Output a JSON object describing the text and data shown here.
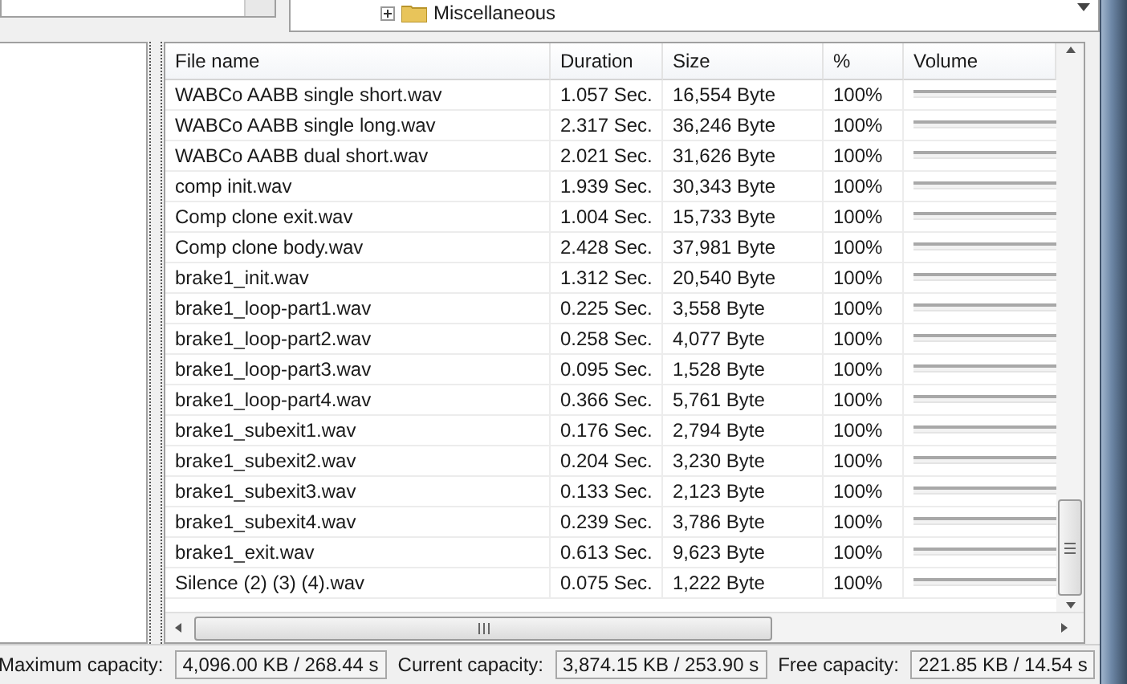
{
  "tree": {
    "items": [
      {
        "label": "Miscellaneous",
        "expanded": false
      }
    ]
  },
  "table": {
    "columns": [
      "File name",
      "Duration",
      "Size",
      "%",
      "Volume"
    ],
    "rows": [
      {
        "file_name": "WABCo AABB single short.wav",
        "duration": "1.057 Sec.",
        "size": "16,554 Byte",
        "percent": "100%",
        "volume": {
          "level": 1
        }
      },
      {
        "file_name": "WABCo AABB single long.wav",
        "duration": "2.317 Sec.",
        "size": "36,246 Byte",
        "percent": "100%",
        "volume": {
          "level": 1
        }
      },
      {
        "file_name": "WABCo AABB dual short.wav",
        "duration": "2.021 Sec.",
        "size": "31,626 Byte",
        "percent": "100%",
        "volume": {
          "level": 1
        }
      },
      {
        "file_name": "comp init.wav",
        "duration": "1.939 Sec.",
        "size": "30,343 Byte",
        "percent": "100%",
        "volume": {
          "level": 1
        }
      },
      {
        "file_name": "Comp clone exit.wav",
        "duration": "1.004 Sec.",
        "size": "15,733 Byte",
        "percent": "100%",
        "volume": {
          "level": 1
        }
      },
      {
        "file_name": "Comp clone body.wav",
        "duration": "2.428 Sec.",
        "size": "37,981 Byte",
        "percent": "100%",
        "volume": {
          "level": 1
        }
      },
      {
        "file_name": "brake1_init.wav",
        "duration": "1.312 Sec.",
        "size": "20,540 Byte",
        "percent": "100%",
        "volume": {
          "level": 1
        }
      },
      {
        "file_name": "brake1_loop-part1.wav",
        "duration": "0.225 Sec.",
        "size": "3,558 Byte",
        "percent": "100%",
        "volume": {
          "level": 1
        }
      },
      {
        "file_name": "brake1_loop-part2.wav",
        "duration": "0.258 Sec.",
        "size": "4,077 Byte",
        "percent": "100%",
        "volume": {
          "level": 1
        }
      },
      {
        "file_name": "brake1_loop-part3.wav",
        "duration": "0.095 Sec.",
        "size": "1,528 Byte",
        "percent": "100%",
        "volume": {
          "level": 1
        }
      },
      {
        "file_name": "brake1_loop-part4.wav",
        "duration": "0.366 Sec.",
        "size": "5,761 Byte",
        "percent": "100%",
        "volume": {
          "level": 1
        }
      },
      {
        "file_name": "brake1_subexit1.wav",
        "duration": "0.176 Sec.",
        "size": "2,794 Byte",
        "percent": "100%",
        "volume": {
          "level": 1
        }
      },
      {
        "file_name": "brake1_subexit2.wav",
        "duration": "0.204 Sec.",
        "size": "3,230 Byte",
        "percent": "100%",
        "volume": {
          "level": 1
        }
      },
      {
        "file_name": "brake1_subexit3.wav",
        "duration": "0.133 Sec.",
        "size": "2,123 Byte",
        "percent": "100%",
        "volume": {
          "level": 1
        }
      },
      {
        "file_name": "brake1_subexit4.wav",
        "duration": "0.239 Sec.",
        "size": "3,786 Byte",
        "percent": "100%",
        "volume": {
          "level": 1
        }
      },
      {
        "file_name": "brake1_exit.wav",
        "duration": "0.613 Sec.",
        "size": "9,623 Byte",
        "percent": "100%",
        "volume": {
          "level": 1
        }
      },
      {
        "file_name": "Silence (2) (3) (4).wav",
        "duration": "0.075 Sec.",
        "size": "1,222 Byte",
        "percent": "100%",
        "volume": {
          "level": 1
        }
      }
    ]
  },
  "status_bar": {
    "fields": [
      {
        "label": "Maximum capacity:",
        "value": "4,096.00 KB / 268.44 s"
      },
      {
        "label": "Current capacity:",
        "value": "3,874.15 KB / 253.90 s"
      },
      {
        "label": "Free capacity:",
        "value": "221.85 KB / 14.54 s"
      }
    ]
  }
}
